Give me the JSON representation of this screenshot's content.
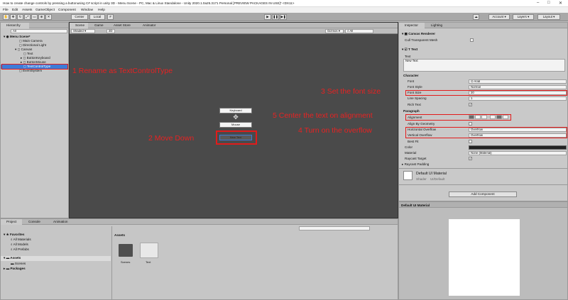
{
  "window": {
    "title": "How to create change controls by pressing a buttonusing C# script in unity 3D - Menu Scene - PC, Mac & Linux Standalone - Unity 2020.1.0a25.3171 Personal [PREVIEW PACKAGES IN USE]* <DX11>",
    "minimize": "–",
    "maximize": "□",
    "close": "✕"
  },
  "menu": [
    "File",
    "Edit",
    "Assets",
    "GameObject",
    "Component",
    "Window",
    "Help"
  ],
  "toolbar": {
    "center": "Center",
    "local": "Local",
    "account": "Account",
    "layers": "Layers",
    "layout": "Layout"
  },
  "hierarchy": {
    "tab": "Hierarchy",
    "search_placeholder": "All",
    "scene": "Menu Scene*",
    "items": [
      "Main Camera",
      "Directional Light",
      "Canvas",
      "Text",
      "ButtonKeyboard",
      "ButtonMouse",
      "TextControlType",
      "EventSystem"
    ]
  },
  "scene_view": {
    "tabs": [
      "Scene",
      "Game",
      "Asset Store",
      "Animator"
    ],
    "shading": "Shaded",
    "mode_2d": "2D",
    "gizmos": "Gizmos",
    "search": "All",
    "buttons": {
      "keyboard": "Keyboard",
      "mouse": "Mouse",
      "selected": "New Text"
    }
  },
  "inspector": {
    "tabs": [
      "Inspector",
      "Lighting"
    ],
    "canvas_renderer": "Canvas Renderer",
    "cull_transparent": "Cull Transparent Mesh",
    "text_component": "Text",
    "text_label": "Text",
    "text_value": "New Text",
    "character_header": "Character",
    "font_label": "Font",
    "font_value": "Arial",
    "font_style_label": "Font Style",
    "font_style_value": "Normal",
    "font_size_label": "Font Size",
    "font_size_value": "20",
    "line_spacing_label": "Line Spacing",
    "line_spacing_value": "1",
    "rich_text_label": "Rich Text",
    "paragraph_header": "Paragraph",
    "alignment_label": "Alignment",
    "align_by_geometry": "Align By Geometry",
    "h_overflow_label": "Horizontal Overflow",
    "h_overflow_value": "Overflow",
    "v_overflow_label": "Vertical Overflow",
    "v_overflow_value": "Overflow",
    "best_fit": "Best Fit",
    "color_label": "Color",
    "material_label": "Material",
    "material_value": "None (Material)",
    "raycast_target": "Raycast Target",
    "raycast_padding": "Raycast Padding",
    "default_material": "Default UI Material",
    "shader_label": "Shader",
    "shader_value": "UI/Default",
    "add_component": "Add Component",
    "preview_title": "Default UI Material"
  },
  "project": {
    "tabs": [
      "Project",
      "Console",
      "Animation"
    ],
    "favorites": "Favorites",
    "fav_items": [
      "All Materials",
      "All Models",
      "All Prefabs"
    ],
    "assets": "Assets",
    "asset_children": [
      "Scenes"
    ],
    "packages": "Packages",
    "assets_header": "Assets",
    "asset_items": [
      "Scenes",
      "Text"
    ]
  },
  "annotations": {
    "a1": "1 Rename as TextControlType",
    "a2": "2 Move Down",
    "a3": "3 Set the font size",
    "a4": "4 Turn on the overflow",
    "a5": "5 Center the text on alignment"
  },
  "colors": {
    "annotation": "#e82222",
    "selection": "#3d7bd8",
    "scene_bg": "#4a4a4a"
  }
}
